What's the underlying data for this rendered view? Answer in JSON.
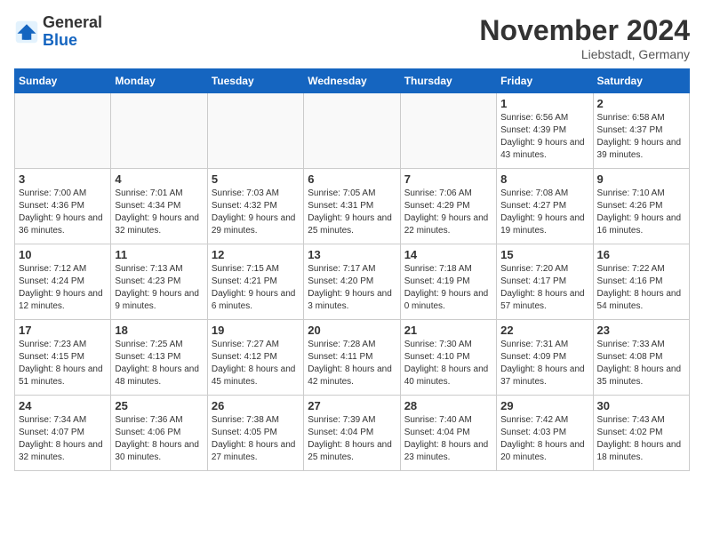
{
  "header": {
    "logo_general": "General",
    "logo_blue": "Blue",
    "month_title": "November 2024",
    "location": "Liebstadt, Germany"
  },
  "days_of_week": [
    "Sunday",
    "Monday",
    "Tuesday",
    "Wednesday",
    "Thursday",
    "Friday",
    "Saturday"
  ],
  "weeks": [
    [
      {
        "day": "",
        "info": ""
      },
      {
        "day": "",
        "info": ""
      },
      {
        "day": "",
        "info": ""
      },
      {
        "day": "",
        "info": ""
      },
      {
        "day": "",
        "info": ""
      },
      {
        "day": "1",
        "info": "Sunrise: 6:56 AM\nSunset: 4:39 PM\nDaylight: 9 hours and 43 minutes."
      },
      {
        "day": "2",
        "info": "Sunrise: 6:58 AM\nSunset: 4:37 PM\nDaylight: 9 hours and 39 minutes."
      }
    ],
    [
      {
        "day": "3",
        "info": "Sunrise: 7:00 AM\nSunset: 4:36 PM\nDaylight: 9 hours and 36 minutes."
      },
      {
        "day": "4",
        "info": "Sunrise: 7:01 AM\nSunset: 4:34 PM\nDaylight: 9 hours and 32 minutes."
      },
      {
        "day": "5",
        "info": "Sunrise: 7:03 AM\nSunset: 4:32 PM\nDaylight: 9 hours and 29 minutes."
      },
      {
        "day": "6",
        "info": "Sunrise: 7:05 AM\nSunset: 4:31 PM\nDaylight: 9 hours and 25 minutes."
      },
      {
        "day": "7",
        "info": "Sunrise: 7:06 AM\nSunset: 4:29 PM\nDaylight: 9 hours and 22 minutes."
      },
      {
        "day": "8",
        "info": "Sunrise: 7:08 AM\nSunset: 4:27 PM\nDaylight: 9 hours and 19 minutes."
      },
      {
        "day": "9",
        "info": "Sunrise: 7:10 AM\nSunset: 4:26 PM\nDaylight: 9 hours and 16 minutes."
      }
    ],
    [
      {
        "day": "10",
        "info": "Sunrise: 7:12 AM\nSunset: 4:24 PM\nDaylight: 9 hours and 12 minutes."
      },
      {
        "day": "11",
        "info": "Sunrise: 7:13 AM\nSunset: 4:23 PM\nDaylight: 9 hours and 9 minutes."
      },
      {
        "day": "12",
        "info": "Sunrise: 7:15 AM\nSunset: 4:21 PM\nDaylight: 9 hours and 6 minutes."
      },
      {
        "day": "13",
        "info": "Sunrise: 7:17 AM\nSunset: 4:20 PM\nDaylight: 9 hours and 3 minutes."
      },
      {
        "day": "14",
        "info": "Sunrise: 7:18 AM\nSunset: 4:19 PM\nDaylight: 9 hours and 0 minutes."
      },
      {
        "day": "15",
        "info": "Sunrise: 7:20 AM\nSunset: 4:17 PM\nDaylight: 8 hours and 57 minutes."
      },
      {
        "day": "16",
        "info": "Sunrise: 7:22 AM\nSunset: 4:16 PM\nDaylight: 8 hours and 54 minutes."
      }
    ],
    [
      {
        "day": "17",
        "info": "Sunrise: 7:23 AM\nSunset: 4:15 PM\nDaylight: 8 hours and 51 minutes."
      },
      {
        "day": "18",
        "info": "Sunrise: 7:25 AM\nSunset: 4:13 PM\nDaylight: 8 hours and 48 minutes."
      },
      {
        "day": "19",
        "info": "Sunrise: 7:27 AM\nSunset: 4:12 PM\nDaylight: 8 hours and 45 minutes."
      },
      {
        "day": "20",
        "info": "Sunrise: 7:28 AM\nSunset: 4:11 PM\nDaylight: 8 hours and 42 minutes."
      },
      {
        "day": "21",
        "info": "Sunrise: 7:30 AM\nSunset: 4:10 PM\nDaylight: 8 hours and 40 minutes."
      },
      {
        "day": "22",
        "info": "Sunrise: 7:31 AM\nSunset: 4:09 PM\nDaylight: 8 hours and 37 minutes."
      },
      {
        "day": "23",
        "info": "Sunrise: 7:33 AM\nSunset: 4:08 PM\nDaylight: 8 hours and 35 minutes."
      }
    ],
    [
      {
        "day": "24",
        "info": "Sunrise: 7:34 AM\nSunset: 4:07 PM\nDaylight: 8 hours and 32 minutes."
      },
      {
        "day": "25",
        "info": "Sunrise: 7:36 AM\nSunset: 4:06 PM\nDaylight: 8 hours and 30 minutes."
      },
      {
        "day": "26",
        "info": "Sunrise: 7:38 AM\nSunset: 4:05 PM\nDaylight: 8 hours and 27 minutes."
      },
      {
        "day": "27",
        "info": "Sunrise: 7:39 AM\nSunset: 4:04 PM\nDaylight: 8 hours and 25 minutes."
      },
      {
        "day": "28",
        "info": "Sunrise: 7:40 AM\nSunset: 4:04 PM\nDaylight: 8 hours and 23 minutes."
      },
      {
        "day": "29",
        "info": "Sunrise: 7:42 AM\nSunset: 4:03 PM\nDaylight: 8 hours and 20 minutes."
      },
      {
        "day": "30",
        "info": "Sunrise: 7:43 AM\nSunset: 4:02 PM\nDaylight: 8 hours and 18 minutes."
      }
    ]
  ]
}
